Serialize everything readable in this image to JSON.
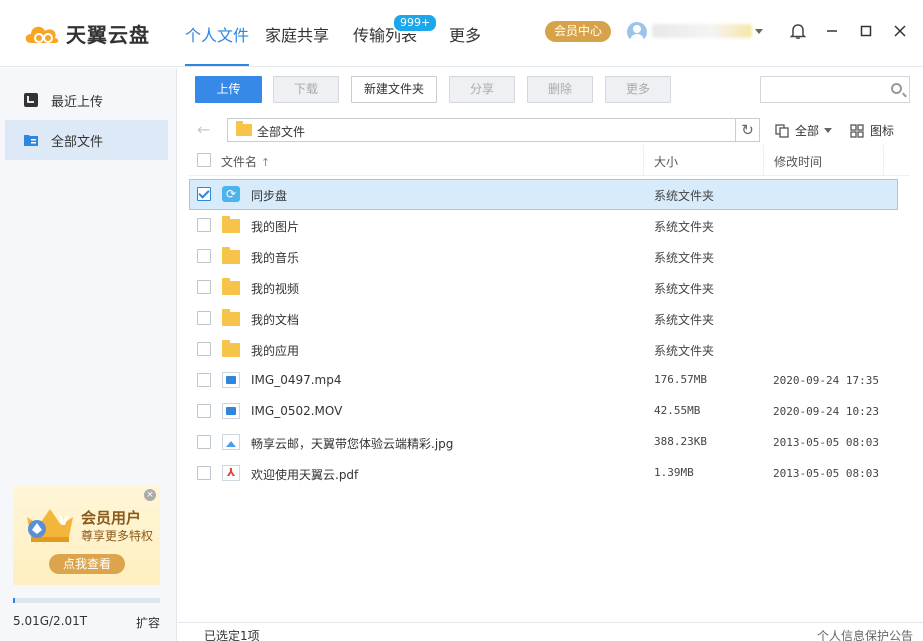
{
  "app": {
    "name": "天翼云盘"
  },
  "nav": {
    "personal": "个人文件",
    "family": "家庭共享",
    "transfer": "传输列表",
    "transfer_badge": "999+",
    "more": "更多"
  },
  "header": {
    "vip_center": "会员中心"
  },
  "sidebar": {
    "items": [
      {
        "label": "最近上传",
        "icon": "recent-icon"
      },
      {
        "label": "全部文件",
        "icon": "all-files-icon"
      }
    ],
    "promo": {
      "title": "会员用户",
      "subtitle": "尊享更多特权",
      "button": "点我查看"
    },
    "storage": {
      "text": "5.01G/2.01T",
      "fraction": 0.0025,
      "expand": "扩容"
    }
  },
  "toolbar": {
    "upload": "上传",
    "download": "下载",
    "new_folder": "新建文件夹",
    "share": "分享",
    "delete": "删除",
    "more": "更多",
    "search_placeholder": ""
  },
  "pathbar": {
    "path": "全部文件",
    "filter": "全部",
    "view": "图标"
  },
  "table": {
    "headers": {
      "name": "文件名",
      "sort_indicator": "↑",
      "size": "大小",
      "time": "修改时间"
    },
    "rows": [
      {
        "name": "同步盘",
        "size": "系统文件夹",
        "time": "",
        "type": "sync",
        "checked": true
      },
      {
        "name": "我的图片",
        "size": "系统文件夹",
        "time": "",
        "type": "folder",
        "checked": false
      },
      {
        "name": "我的音乐",
        "size": "系统文件夹",
        "time": "",
        "type": "folder",
        "checked": false
      },
      {
        "name": "我的视频",
        "size": "系统文件夹",
        "time": "",
        "type": "folder",
        "checked": false
      },
      {
        "name": "我的文档",
        "size": "系统文件夹",
        "time": "",
        "type": "folder",
        "checked": false
      },
      {
        "name": "我的应用",
        "size": "系统文件夹",
        "time": "",
        "type": "folder",
        "checked": false
      },
      {
        "name": "IMG_0497.mp4",
        "size": "176.57MB",
        "time": "2020-09-24 17:35",
        "type": "video",
        "checked": false
      },
      {
        "name": "IMG_0502.MOV",
        "size": "42.55MB",
        "time": "2020-09-24 10:23",
        "type": "video",
        "checked": false
      },
      {
        "name": "畅享云邮，天翼带您体验云端精彩.jpg",
        "size": "388.23KB",
        "time": "2013-05-05 08:03",
        "type": "image",
        "checked": false
      },
      {
        "name": "欢迎使用天翼云.pdf",
        "size": "1.39MB",
        "time": "2013-05-05 08:03",
        "type": "pdf",
        "checked": false
      }
    ]
  },
  "status": {
    "selected": "已选定1项",
    "privacy": "个人信息保护公告"
  },
  "colors": {
    "accent": "#2e86de",
    "vip": "#d6a24a",
    "folder": "#f7c44a"
  }
}
